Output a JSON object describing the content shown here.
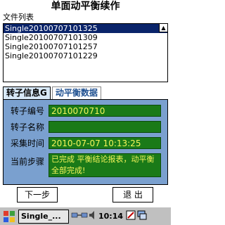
{
  "title": "单面动平衡续作",
  "file_list": {
    "label": "文件列表",
    "items": [
      "Single20100707101325",
      "Single20100707101309",
      "Single20100707101257",
      "Single20100707101229"
    ],
    "selected_index": 0
  },
  "tabs": [
    "转子信息G",
    "动平衡数据"
  ],
  "form": {
    "rotor_no_label": "转子编号",
    "rotor_no": "2010070710",
    "rotor_name_label": "转子名称",
    "rotor_name": "",
    "time_label": "采集时间",
    "time": "2010-07-07 10:13:25",
    "step_label": "当前步骤",
    "step": "已完成 平衡结论报表，动平衡全部完成!"
  },
  "buttons": {
    "next": "下一步",
    "exit": "退 出"
  },
  "taskbar": {
    "task": "Single_...",
    "clock": "10:14"
  },
  "colors": {
    "panel": "#7aa0cf",
    "field": "#1a7a18",
    "field_text": "#f5f55a",
    "selection": "#0a246a"
  }
}
